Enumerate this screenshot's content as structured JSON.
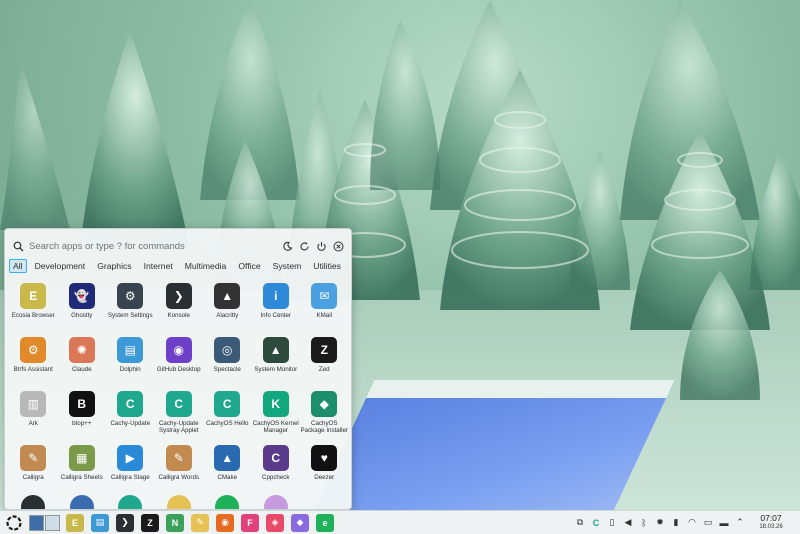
{
  "launcher": {
    "search_placeholder": "Search apps or type ? for commands",
    "tabs": [
      "All",
      "Development",
      "Graphics",
      "Internet",
      "Multimedia",
      "Office",
      "System",
      "Utilities"
    ],
    "active_tab": "All",
    "apps": [
      {
        "label": "Ecosia Browser",
        "icon": "ecosia-icon",
        "color": "#c9b84a"
      },
      {
        "label": "Ghostty",
        "icon": "ghostty-icon",
        "color": "#1f2a78"
      },
      {
        "label": "System Settings",
        "icon": "system-settings-icon",
        "color": "#3a4450"
      },
      {
        "label": "Konsole",
        "icon": "konsole-icon",
        "color": "#2a2f33"
      },
      {
        "label": "Alacritty",
        "icon": "alacritty-icon",
        "color": "#333333"
      },
      {
        "label": "Info Center",
        "icon": "info-center-icon",
        "color": "#2e8ad8"
      },
      {
        "label": "KMail",
        "icon": "kmail-icon",
        "color": "#4aa0e0"
      },
      {
        "label": "Btrfs Assistant",
        "icon": "btrfs-icon",
        "color": "#e08a2a"
      },
      {
        "label": "Claude",
        "icon": "claude-icon",
        "color": "#d97757"
      },
      {
        "label": "Dolphin",
        "icon": "dolphin-icon",
        "color": "#3d9ad6"
      },
      {
        "label": "GitHub Desktop",
        "icon": "github-desktop-icon",
        "color": "#6e40c9"
      },
      {
        "label": "Spectacle",
        "icon": "spectacle-icon",
        "color": "#3a5a78"
      },
      {
        "label": "System Monitor",
        "icon": "system-monitor-icon",
        "color": "#2e4a3e"
      },
      {
        "label": "Zed",
        "icon": "zed-icon",
        "color": "#1a1a1a"
      },
      {
        "label": "Ark",
        "icon": "ark-icon",
        "color": "#b8b8b8"
      },
      {
        "label": "btop++",
        "icon": "btop-icon",
        "color": "#111111"
      },
      {
        "label": "Cachy-Update",
        "icon": "cachy-update-icon",
        "color": "#1fa88e"
      },
      {
        "label": "Cachy-Update Systray Applet",
        "icon": "cachy-applet-icon",
        "color": "#1fa88e"
      },
      {
        "label": "CachyOS Hello",
        "icon": "cachyos-hello-icon",
        "color": "#1fa88e"
      },
      {
        "label": "CachyOS Kernel Manager",
        "icon": "kernel-manager-icon",
        "color": "#13a77f"
      },
      {
        "label": "CachyOS Package Installer",
        "icon": "package-installer-icon",
        "color": "#1d8e6b"
      },
      {
        "label": "Calligra",
        "icon": "calligra-icon",
        "color": "#c08a50"
      },
      {
        "label": "Calligra Sheets",
        "icon": "calligra-sheets-icon",
        "color": "#7a9a4a"
      },
      {
        "label": "Calligra Stage",
        "icon": "calligra-stage-icon",
        "color": "#2a8ad8"
      },
      {
        "label": "Calligra Words",
        "icon": "calligra-words-icon",
        "color": "#c08a50"
      },
      {
        "label": "CMake",
        "icon": "cmake-icon",
        "color": "#2a6ab0"
      },
      {
        "label": "Cppcheck",
        "icon": "cppcheck-icon",
        "color": "#5a3a8a"
      },
      {
        "label": "Deezer",
        "icon": "deezer-icon",
        "color": "#111111"
      }
    ],
    "glyphs": [
      "E",
      "👻",
      "⚙",
      "❯",
      "▲",
      "i",
      "✉",
      "⚙",
      "✺",
      "▤",
      "◉",
      "◎",
      "▲",
      "Z",
      "▥",
      "B",
      "C",
      "C",
      "C",
      "K",
      "◆",
      "✎",
      "▦",
      "▶",
      "✎",
      "▲",
      "C",
      "♥"
    ]
  },
  "taskbar": {
    "apps": [
      {
        "name": "ecosia",
        "color": "#c9b84a",
        "glyph": "E"
      },
      {
        "name": "dolphin",
        "color": "#3d9ad6",
        "glyph": "▤"
      },
      {
        "name": "konsole",
        "color": "#2a2f33",
        "glyph": "❯"
      },
      {
        "name": "zed",
        "color": "#1a1a1a",
        "glyph": "Z"
      },
      {
        "name": "neovim",
        "color": "#3aa05a",
        "glyph": "N"
      },
      {
        "name": "notes",
        "color": "#e6c255",
        "glyph": "✎"
      },
      {
        "name": "firefox",
        "color": "#e66a1f",
        "glyph": "◉"
      },
      {
        "name": "jetbrains",
        "color": "#e0417a",
        "glyph": "F"
      },
      {
        "name": "keepass",
        "color": "#e84a6a",
        "glyph": "◈"
      },
      {
        "name": "proton",
        "color": "#8a6ae0",
        "glyph": "◆"
      },
      {
        "name": "ecosia-green",
        "color": "#1fb05a",
        "glyph": "e"
      }
    ],
    "clock_time": "07:07",
    "clock_date": "18.03.26"
  }
}
